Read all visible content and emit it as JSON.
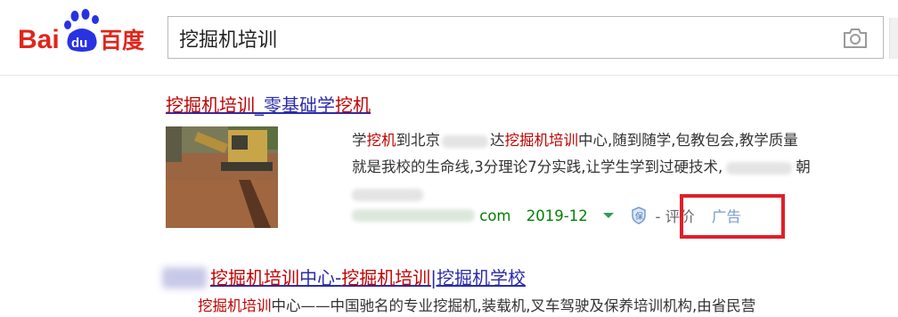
{
  "logo": {
    "text_left": "Bai",
    "text_paw": "du",
    "text_right": "百度"
  },
  "search": {
    "value": "挖掘机培训"
  },
  "ad_result": {
    "title_parts": [
      "挖掘机培训",
      "_零基础学",
      "挖机"
    ],
    "desc_line1": [
      "学",
      "挖机",
      "到北京",
      "达",
      "挖掘机培训",
      "中心,随到随学,包教包会,教学质量"
    ],
    "desc_line2": [
      "就是我校的生命线,3分理论7分实践,让学生学到过硬技术,",
      "朝"
    ],
    "url": "com",
    "date": "2019-12",
    "review": "- 评价",
    "ad_label": "广告"
  },
  "result2": {
    "title_parts": [
      "挖掘机培训",
      "中心-",
      "挖掘机培训",
      "|挖掘机学校"
    ],
    "desc_parts": [
      "挖掘机培训",
      "中心——中国驰名的专业挖掘机,装载机,叉车驾驶及保养培训机构,由省民营"
    ]
  },
  "colors": {
    "link": "#2b2bab",
    "highlight": "#c00000",
    "url_green": "#008000",
    "ad_blue": "#7a9bcc",
    "annotation_red": "#e0202a"
  }
}
